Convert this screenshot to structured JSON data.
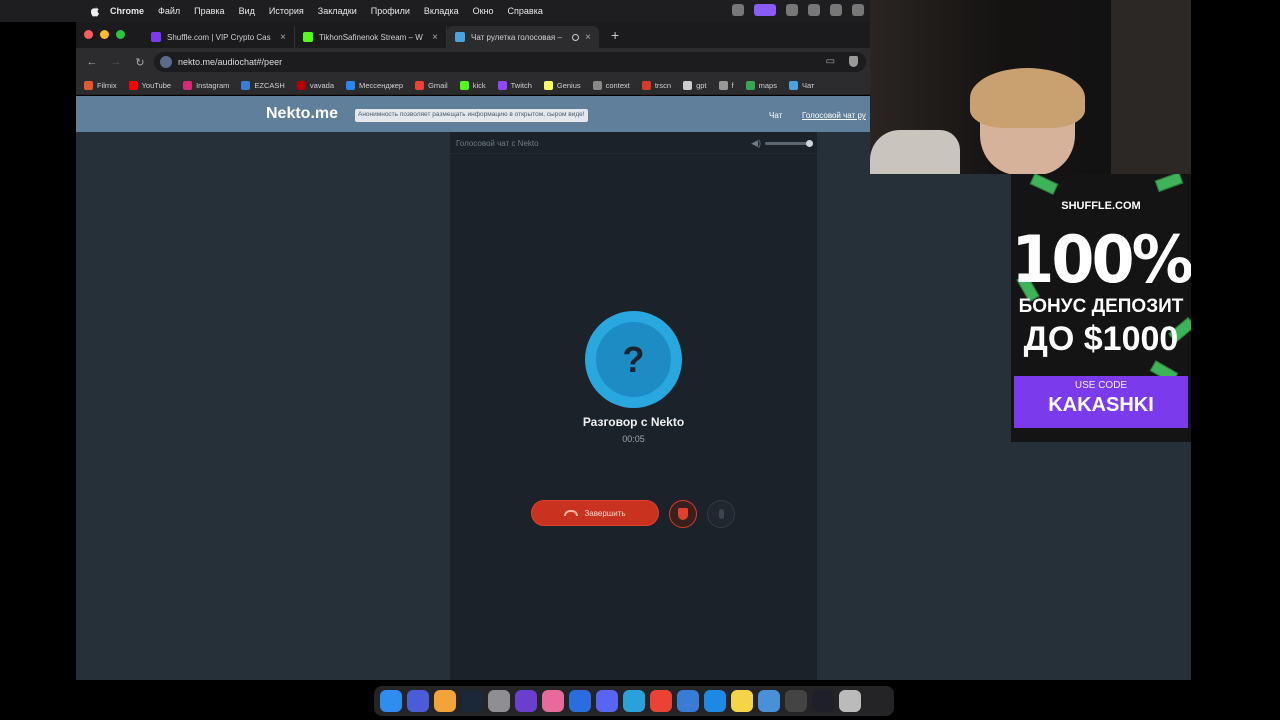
{
  "menubar": {
    "app_name": "Chrome",
    "items": [
      "Файл",
      "Правка",
      "Вид",
      "История",
      "Закладки",
      "Профили",
      "Вкладка",
      "Окно",
      "Справка"
    ]
  },
  "tabs": [
    {
      "title": "Shuffle.com | VIP Crypto Cas",
      "favicon_color": "#7c3aed"
    },
    {
      "title": "TikhonSafinenok Stream – W",
      "favicon_color": "#53fc18"
    },
    {
      "title": "Чат рулетка голосовая –",
      "favicon_color": "#4aa3df",
      "active": true
    }
  ],
  "toolbar": {
    "url": "nekto.me/audiochat#/peer"
  },
  "bookmarks": [
    {
      "label": "Filmix",
      "color": "#e05a2a"
    },
    {
      "label": "YouTube",
      "color": "#ff0000"
    },
    {
      "label": "Instagram",
      "color": "#d62976"
    },
    {
      "label": "EZCASH",
      "color": "#3a7bd5"
    },
    {
      "label": "vavada",
      "color": "#b30000"
    },
    {
      "label": "Мессенджер",
      "color": "#2787f5"
    },
    {
      "label": "Gmail",
      "color": "#ea4335"
    },
    {
      "label": "kick",
      "color": "#53fc18"
    },
    {
      "label": "Twitch",
      "color": "#9146ff"
    },
    {
      "label": "Genius",
      "color": "#ffff64"
    },
    {
      "label": "context",
      "color": "#888888"
    },
    {
      "label": "trscn",
      "color": "#d83a2a"
    },
    {
      "label": "gpt",
      "color": "#cccccc"
    },
    {
      "label": "f",
      "color": "#999999"
    },
    {
      "label": "maps",
      "color": "#34a853"
    },
    {
      "label": "Чат",
      "color": "#4aa3df"
    }
  ],
  "site": {
    "logo": "Nekto.me",
    "notice": "Анонимность позволяет размещать информацию в открытом, сыром виде!",
    "nav_chat": "Чат",
    "nav_voice": "Голосовой чат ру"
  },
  "chat": {
    "header_title": "Голосовой чат с Nekto",
    "avatar_symbol": "?",
    "peer_name": "Разговор с Nekto",
    "timer": "00:05",
    "end_button": "Завершить"
  },
  "ad": {
    "brand": "SHUFFLE.COM",
    "headline": "100%",
    "line2": "БОНУС ДЕПОЗИТ",
    "line3": "ДО $1000",
    "use_code_label": "USE CODE",
    "code": "KAKASHKI",
    "accent_color": "#7c3aed"
  },
  "colors": {
    "site_header": "#5f7f9a",
    "page_bg": "#263038",
    "avatar": "#29a8e0",
    "end_button": "#c8321f"
  }
}
